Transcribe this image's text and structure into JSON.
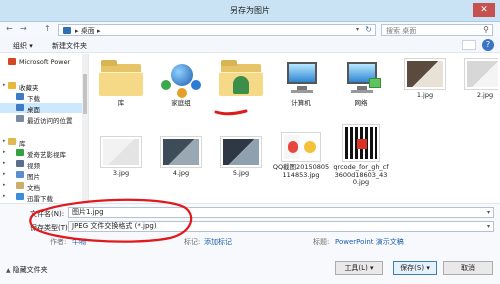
{
  "window": {
    "title": "另存为图片",
    "close_glyph": "✕"
  },
  "address": {
    "crumbs": "▸  桌面  ▸",
    "back_glyph": "←",
    "forward_glyph": "→",
    "up_glyph": "↑",
    "refresh_glyph": "↻",
    "search_placeholder": "搜索 桌面"
  },
  "toolbar": {
    "organize": "组织 ▾",
    "new_folder": "新建文件夹",
    "help": "?"
  },
  "sidebar": {
    "items": [
      {
        "label": "Microsoft Power",
        "icon": "powerpoint-icon",
        "color": "#d24726"
      },
      {
        "label": "收藏夹",
        "icon": "star-icon",
        "color": "#e8b83a"
      },
      {
        "label": "下载",
        "icon": "download-folder-icon",
        "color": "#3d7bc4"
      },
      {
        "label": "桌面",
        "icon": "desktop-icon",
        "color": "#3d7bc4"
      },
      {
        "label": "最近访问的位置",
        "icon": "recent-places-icon",
        "color": "#7a8aa0"
      },
      {
        "label": "库",
        "icon": "library-icon",
        "color": "#e0b84e"
      },
      {
        "label": "爱奇艺影视库",
        "icon": "video-library-icon",
        "color": "#35a13c"
      },
      {
        "label": "视频",
        "icon": "video-icon",
        "color": "#5a6f8c"
      },
      {
        "label": "图片",
        "icon": "pictures-icon",
        "color": "#5a8fcf"
      },
      {
        "label": "文档",
        "icon": "documents-icon",
        "color": "#c9b06a"
      },
      {
        "label": "迅雷下载",
        "icon": "thunder-download-icon",
        "color": "#3c8fd6"
      }
    ]
  },
  "files": [
    {
      "name": "库",
      "icon": "library-folder-icon"
    },
    {
      "name": "家庭组",
      "icon": "homegroup-icon"
    },
    {
      "name": "",
      "icon": "user-folder-icon"
    },
    {
      "name": "计算机",
      "icon": "computer-icon"
    },
    {
      "name": "网络",
      "icon": "network-icon"
    },
    {
      "name": "1.jpg",
      "icon": "image-thumb"
    },
    {
      "name": "2.jpg",
      "icon": "image-thumb"
    },
    {
      "name": "3.jpg",
      "icon": "image-thumb"
    },
    {
      "name": "4.jpg",
      "icon": "image-thumb"
    },
    {
      "name": "5.jpg",
      "icon": "image-thumb"
    },
    {
      "name": "QQ截图20150805114853.jpg",
      "icon": "image-thumb"
    },
    {
      "name": "qrcode_for_gh_cf3600d18603_430.jpg",
      "icon": "qrcode-thumb"
    }
  ],
  "form": {
    "filename_label": "文件名(N):",
    "filename_value": "图片1.jpg",
    "type_label": "保存类型(T):",
    "type_value": "JPEG 文件交换格式 (*.jpg)",
    "authors_label": "作者:",
    "authors_value": "牛嗝",
    "tags_label": "标记:",
    "tags_value": "添加标记",
    "title_label": "标题:",
    "title_value": "PowerPoint 演示文稿"
  },
  "footer": {
    "hide_folders": "隐藏文件夹",
    "tools": "工具(L)",
    "save": "保存(S)",
    "cancel": "取消"
  },
  "colors": {
    "annotation_red": "#e0191c",
    "titlebar": "#c9e3f5",
    "selection": "#cce8ff"
  }
}
